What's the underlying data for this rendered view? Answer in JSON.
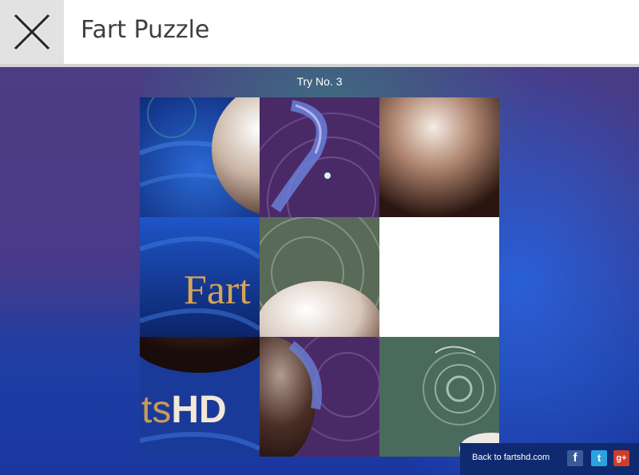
{
  "header": {
    "title": "Fart Puzzle",
    "close_icon": "close-x-icon"
  },
  "game": {
    "try_label": "Try No. 3",
    "tile_labels": {
      "fart": "Fart",
      "hd_suffix": "ts",
      "hd": "HD"
    },
    "empty_slot": {
      "row": 1,
      "col": 2
    }
  },
  "footer": {
    "back_link": "Back to fartshd.com",
    "social": [
      {
        "name": "facebook",
        "glyph": "f",
        "color": "#3b5a9a"
      },
      {
        "name": "twitter",
        "glyph": "t",
        "color": "#2ba3e0"
      },
      {
        "name": "google-plus",
        "glyph": "g+",
        "color": "#d03c2a"
      }
    ]
  }
}
